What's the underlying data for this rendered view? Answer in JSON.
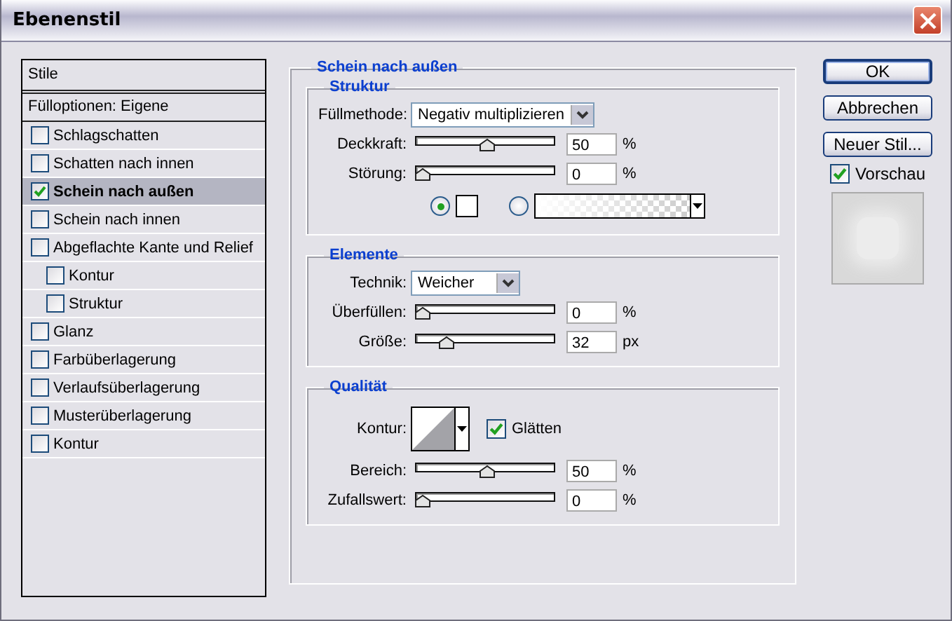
{
  "window": {
    "title": "Ebenenstil"
  },
  "styles": {
    "header": "Stile",
    "blend_options": "Fülloptionen: Eigene",
    "items": [
      {
        "label": "Schlagschatten",
        "checked": false,
        "selected": false
      },
      {
        "label": "Schatten nach innen",
        "checked": false,
        "selected": false
      },
      {
        "label": "Schein nach außen",
        "checked": true,
        "selected": true
      },
      {
        "label": "Schein nach innen",
        "checked": false,
        "selected": false
      },
      {
        "label": "Abgeflachte Kante und Relief",
        "checked": false,
        "selected": false,
        "children": [
          {
            "label": "Kontur",
            "checked": false,
            "selected": false
          },
          {
            "label": "Struktur",
            "checked": false,
            "selected": false
          }
        ]
      },
      {
        "label": "Glanz",
        "checked": false,
        "selected": false
      },
      {
        "label": "Farbüberlagerung",
        "checked": false,
        "selected": false
      },
      {
        "label": "Verlaufsüberlagerung",
        "checked": false,
        "selected": false
      },
      {
        "label": "Musterüberlagerung",
        "checked": false,
        "selected": false
      },
      {
        "label": "Kontur",
        "checked": false,
        "selected": false
      }
    ]
  },
  "panel": {
    "title": "Schein nach außen",
    "groups": [
      {
        "title": "Struktur",
        "rows": [
          {
            "kind": "select",
            "label": "Füllmethode:",
            "value": "Negativ multiplizieren"
          },
          {
            "kind": "slider",
            "label": "Deckkraft:",
            "level": 0.5,
            "value": "50",
            "unit": "%"
          },
          {
            "kind": "slider",
            "label": "Störung:",
            "level": 0,
            "value": "0",
            "unit": "%"
          },
          {
            "kind": "fill",
            "options": [
              {
                "kind": "color",
                "selected": true,
                "color": "#ffffff"
              },
              {
                "kind": "gradient",
                "selected": false
              }
            ]
          }
        ]
      },
      {
        "title": "Elemente",
        "rows": [
          {
            "kind": "select",
            "label": "Technik:",
            "value": "Weicher"
          },
          {
            "kind": "slider",
            "label": "Überfüllen:",
            "level": 0,
            "value": "0",
            "unit": "%"
          },
          {
            "kind": "slider",
            "label": "Größe:",
            "level": 0.18,
            "value": "32",
            "unit": "px"
          }
        ]
      },
      {
        "title": "Qualität",
        "rows": [
          {
            "kind": "contour",
            "label": "Kontur:",
            "option": {
              "label": "Glätten",
              "checked": true
            }
          },
          {
            "kind": "slider",
            "label": "Bereich:",
            "level": 0.5,
            "value": "50",
            "unit": "%"
          },
          {
            "kind": "slider",
            "label": "Zufallswert:",
            "level": 0,
            "value": "0",
            "unit": "%"
          }
        ]
      }
    ]
  },
  "buttons": [
    {
      "label": "OK",
      "default": true
    },
    {
      "label": "Abbrechen",
      "default": false
    },
    {
      "label": "Neuer Stil...",
      "default": false
    }
  ],
  "preview": {
    "label": "Vorschau",
    "checked": true
  }
}
